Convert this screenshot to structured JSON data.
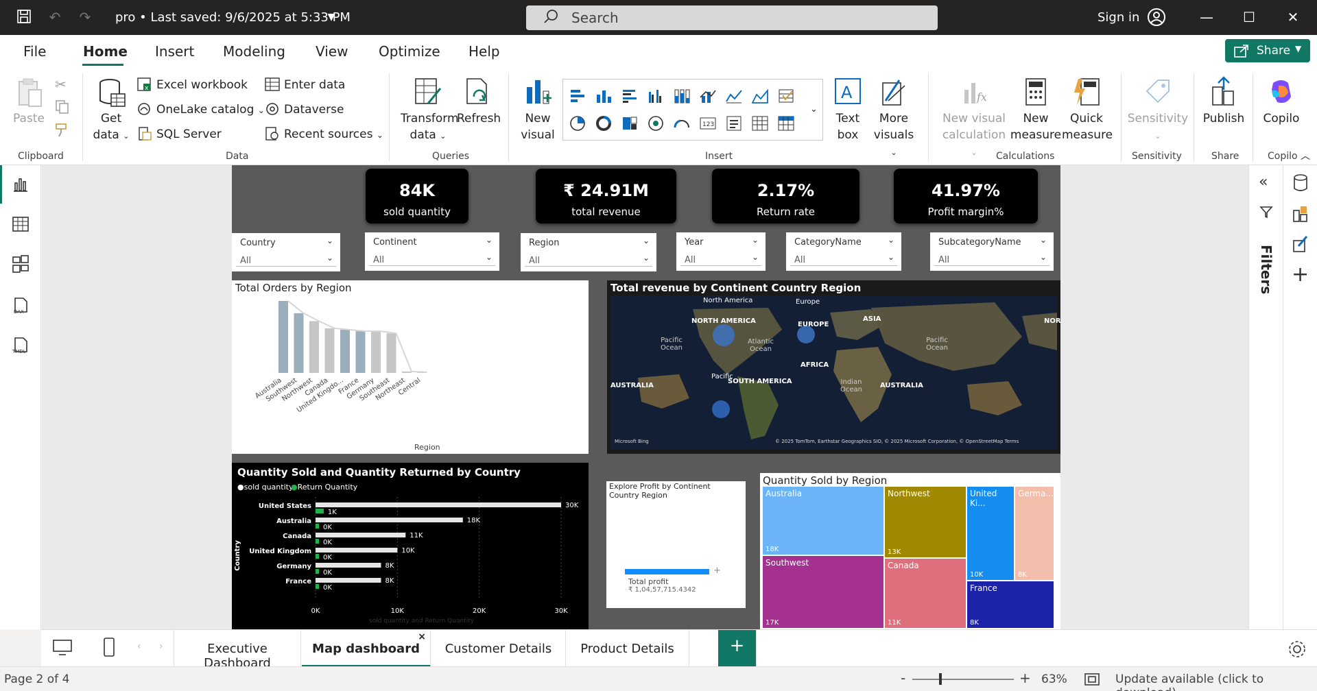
{
  "titlebar": {
    "doc_title": "pro • Last saved: 9/6/2025 at 5:33 PM",
    "search_placeholder": "Search",
    "signin": "Sign in"
  },
  "menu": {
    "items": [
      "File",
      "Home",
      "Insert",
      "Modeling",
      "View",
      "Optimize",
      "Help"
    ],
    "active": "Home",
    "share": "Share"
  },
  "ribbon": {
    "clipboard": {
      "paste": "Paste",
      "label": "Clipboard"
    },
    "data": {
      "get_data": "Get",
      "get_data2": "data",
      "excel": "Excel workbook",
      "onelake": "OneLake catalog",
      "sql": "SQL Server",
      "enter_data": "Enter data",
      "dataverse": "Dataverse",
      "recent": "Recent sources",
      "label": "Data"
    },
    "queries": {
      "transform": "Transform",
      "transform2": "data",
      "refresh": "Refresh",
      "label": "Queries"
    },
    "insert": {
      "new_visual": "New",
      "new_visual2": "visual",
      "text_box": "Text",
      "text_box2": "box",
      "more_visuals": "More",
      "more_visuals2": "visuals",
      "label": "Insert"
    },
    "calculations": {
      "new_visual_calc": "New visual",
      "new_visual_calc2": "calculation",
      "new_measure": "New",
      "new_measure2": "measure",
      "quick_measure": "Quick",
      "quick_measure2": "measure",
      "label": "Calculations"
    },
    "sensitivity": {
      "btn": "Sensitivity",
      "label": "Sensitivity"
    },
    "share": {
      "publish": "Publish",
      "label": "Share"
    },
    "copilot": {
      "btn": "Copilo",
      "label": "Copilo"
    }
  },
  "kpis": [
    {
      "value": "84K",
      "label": "sold quantity"
    },
    {
      "value": "₹ 24.91M",
      "label": "total revenue"
    },
    {
      "value": "2.17%",
      "label": "Return rate"
    },
    {
      "value": "41.97%",
      "label": "Profit margin%"
    }
  ],
  "slicers": [
    {
      "name": "Country",
      "value": "All"
    },
    {
      "name": "Continent",
      "value": "All"
    },
    {
      "name": "Region",
      "value": "All"
    },
    {
      "name": "Year",
      "value": "All"
    },
    {
      "name": "CategoryName",
      "value": "All"
    },
    {
      "name": "SubcategoryName",
      "value": "All"
    }
  ],
  "visuals": {
    "orders": {
      "title": "Total Orders by Region",
      "xlabel": "Region"
    },
    "map": {
      "title": "Total revenue by Continent Country Region",
      "labels": [
        "North America",
        "NORTH AMERICA",
        "Europe",
        "EUROPE",
        "ASIA",
        "NOR",
        "Pacific Ocean",
        "Atlantic Ocean",
        "Pacific Ocean",
        "AFRICA",
        "Pacific",
        "SOUTH AMERICA",
        "Indian Ocean",
        "AUSTRALIA",
        "AUSTRALIA"
      ],
      "attribution": "© 2025 TomTom, Earthstar Geographics SIO, © 2025 Microsoft Corporation, © OpenStreetMap  Terms",
      "bing": "Microsoft Bing"
    },
    "qty": {
      "title": "Quantity Sold and Quantity Returned by Country",
      "legend": [
        "sold quantity",
        "Return Quantity"
      ],
      "ylabel": "Country",
      "xlabel": "sold quantity and Return Quantity"
    },
    "profit": {
      "title": "Explore Profit by Continent Country Region",
      "label": "Total profit",
      "value": "₹ 1,04,57,715.4342"
    },
    "treemap": {
      "title": "Quantity Sold by Region"
    }
  },
  "chart_data": [
    {
      "type": "bar",
      "title": "Total Orders by Region",
      "xlabel": "Region",
      "categories": [
        "Australia",
        "Southwest",
        "Northwest",
        "Canada",
        "United Kingdo...",
        "France",
        "Germany",
        "Southeast",
        "Northeast",
        "Central"
      ],
      "values": [
        100,
        83,
        72,
        62,
        60,
        58,
        58,
        55,
        2,
        1
      ],
      "note_colors": [
        "#9aaebb",
        "#c6c6c6"
      ]
    },
    {
      "type": "bar",
      "title": "Quantity Sold and Quantity Returned by Country",
      "orientation": "horizontal",
      "categories": [
        "United States",
        "Australia",
        "Canada",
        "United Kingdom",
        "Germany",
        "France"
      ],
      "series": [
        {
          "name": "sold quantity",
          "values": [
            30,
            18,
            11,
            10,
            8,
            8
          ],
          "labels": [
            "30K",
            "18K",
            "11K",
            "10K",
            "8K",
            "8K"
          ]
        },
        {
          "name": "Return Quantity",
          "values": [
            1,
            0.4,
            0.3,
            0.3,
            0.2,
            0.2
          ],
          "labels": [
            "1K",
            "0K",
            "0K",
            "0K",
            "0K",
            "0K"
          ]
        }
      ],
      "xticks": [
        "0K",
        "10K",
        "20K",
        "30K"
      ],
      "xlim": [
        0,
        30
      ]
    },
    {
      "type": "treemap",
      "title": "Quantity Sold by Region",
      "items": [
        {
          "name": "Australia",
          "label": "18K",
          "value": 18,
          "color": "#6ab4f7"
        },
        {
          "name": "Southwest",
          "label": "17K",
          "value": 17,
          "color": "#a4308f"
        },
        {
          "name": "Northwest",
          "label": "13K",
          "value": 13,
          "color": "#a08800"
        },
        {
          "name": "Canada",
          "label": "11K",
          "value": 11,
          "color": "#e06f7e"
        },
        {
          "name": "United Ki...",
          "label": "10K",
          "value": 10,
          "color": "#148cf0"
        },
        {
          "name": "Germa...",
          "label": "8K",
          "value": 8,
          "color": "#f3bdab"
        },
        {
          "name": "France",
          "label": "8K",
          "value": 8,
          "color": "#1c23a8"
        }
      ]
    }
  ],
  "right_pane": {
    "filters": "Filters"
  },
  "tabs": {
    "items": [
      "Executive Dashboard",
      "Map dashboard",
      "Customer Details",
      "Product Details"
    ],
    "active": "Map dashboard",
    "add": "+"
  },
  "status": {
    "page": "Page 2 of 4",
    "zoom": "63%",
    "update": "Update available (click to download)"
  }
}
